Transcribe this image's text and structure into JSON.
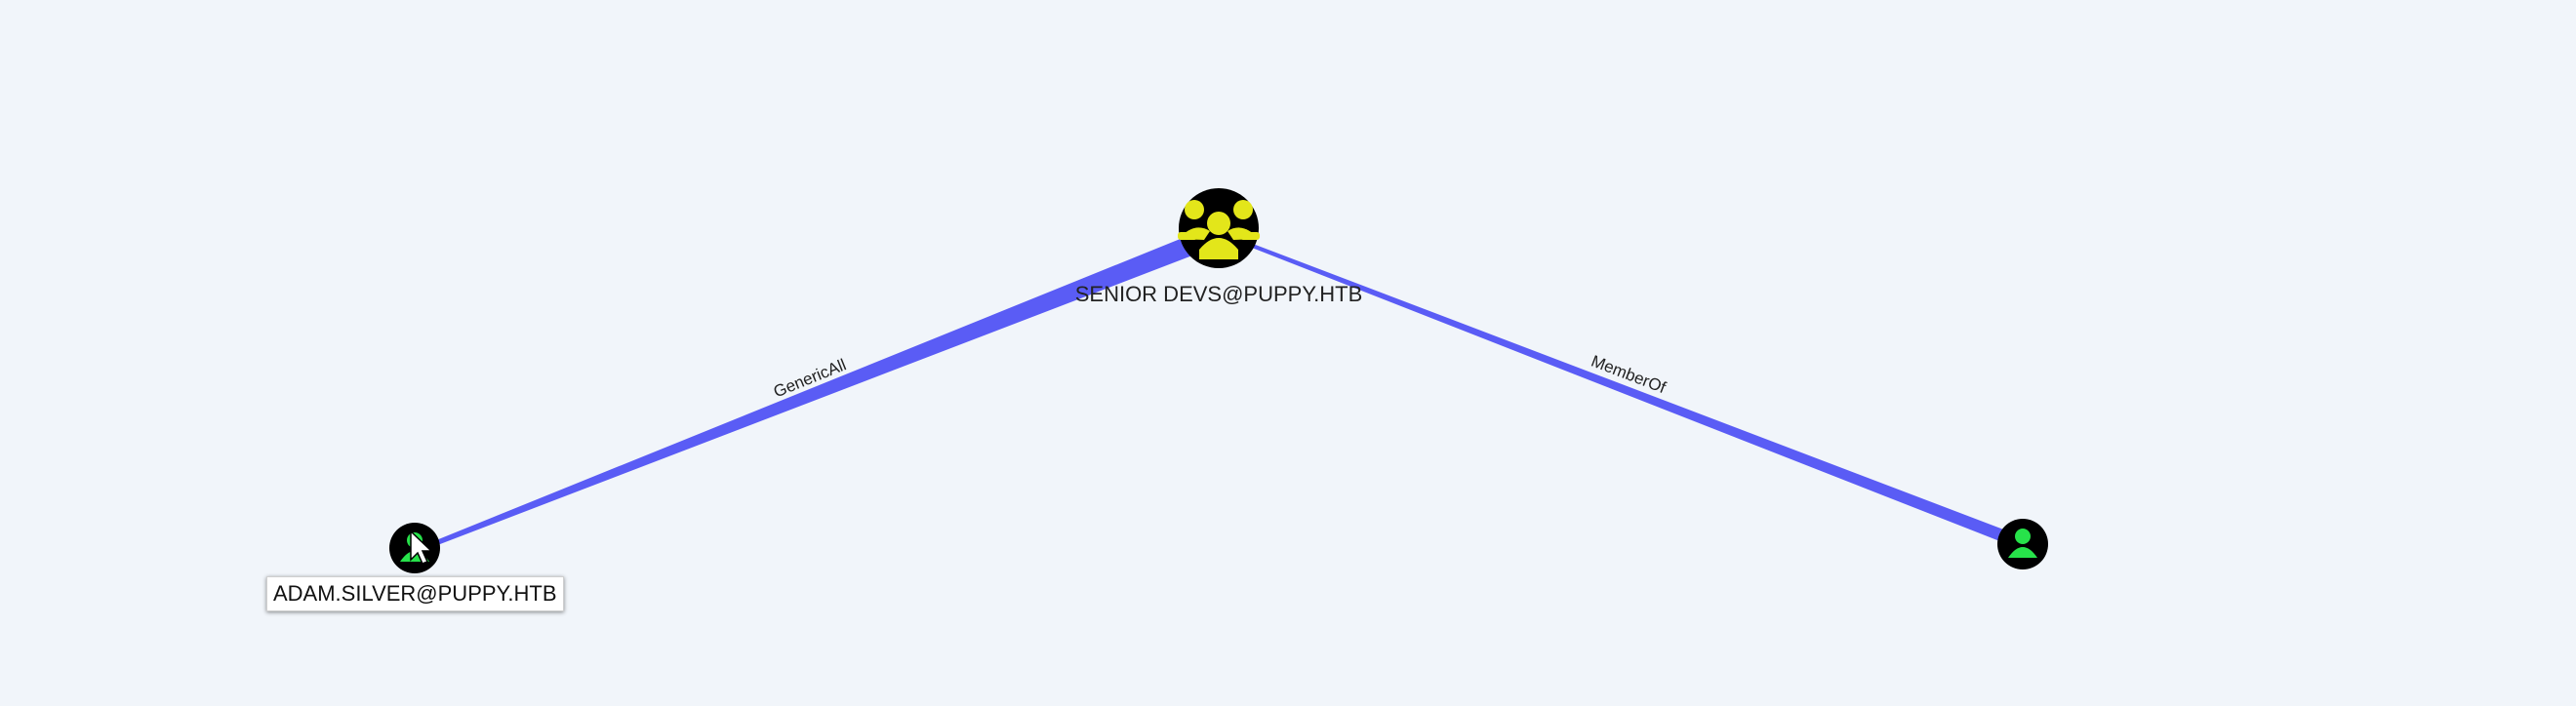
{
  "graph": {
    "nodes": {
      "group": {
        "label": "SENIOR DEVS@PUPPY.HTB",
        "type": "group",
        "icon": "users-group-icon",
        "icon_color": "#e3e61a",
        "fill": "#000000"
      },
      "user_left": {
        "label": "ADAM.SILVER@PUPPY.HTB",
        "type": "user",
        "icon": "user-icon",
        "icon_color": "#27e24a",
        "fill": "#000000",
        "selected": true
      },
      "user_right": {
        "label": "",
        "type": "user",
        "icon": "user-icon",
        "icon_color": "#27e24a",
        "fill": "#000000"
      }
    },
    "edges": {
      "generic_all": {
        "label": "GenericAll",
        "from": "user_left",
        "to": "group",
        "color": "#5a5cf5"
      },
      "member_of": {
        "label": "MemberOf",
        "from": "user_right",
        "to": "group",
        "color": "#5a5cf5"
      }
    }
  }
}
